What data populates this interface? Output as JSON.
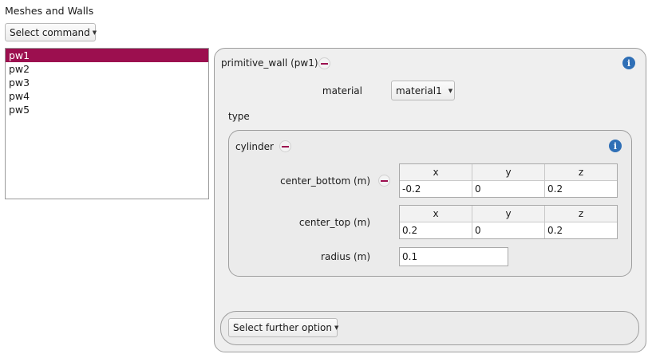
{
  "section": {
    "title": "Meshes and Walls"
  },
  "command_button": {
    "label": "Select command"
  },
  "wall_list": [
    {
      "label": "pw1",
      "selected": true
    },
    {
      "label": "pw2",
      "selected": false
    },
    {
      "label": "pw3",
      "selected": false
    },
    {
      "label": "pw4",
      "selected": false
    },
    {
      "label": "pw5",
      "selected": false
    }
  ],
  "panel": {
    "title": "primitive_wall (pw1)",
    "material_label": "material",
    "material_value": "material1",
    "type_label": "type",
    "cylinder": {
      "title": "cylinder",
      "center_bottom": {
        "label": "center_bottom (m)",
        "headers": [
          "x",
          "y",
          "z"
        ],
        "values": [
          "-0.2",
          "0",
          "0.2"
        ]
      },
      "center_top": {
        "label": "center_top (m)",
        "headers": [
          "x",
          "y",
          "z"
        ],
        "values": [
          "0.2",
          "0",
          "0.2"
        ]
      },
      "radius": {
        "label": "radius (m)",
        "value": "0.1"
      }
    },
    "further_button": {
      "label": "Select further option"
    }
  },
  "icons": {
    "info": "info-icon",
    "remove": "minus-icon",
    "dropdown": "chevron-down-icon"
  },
  "colors": {
    "accent": "#9c0f4f",
    "info": "#2f6fb6"
  }
}
